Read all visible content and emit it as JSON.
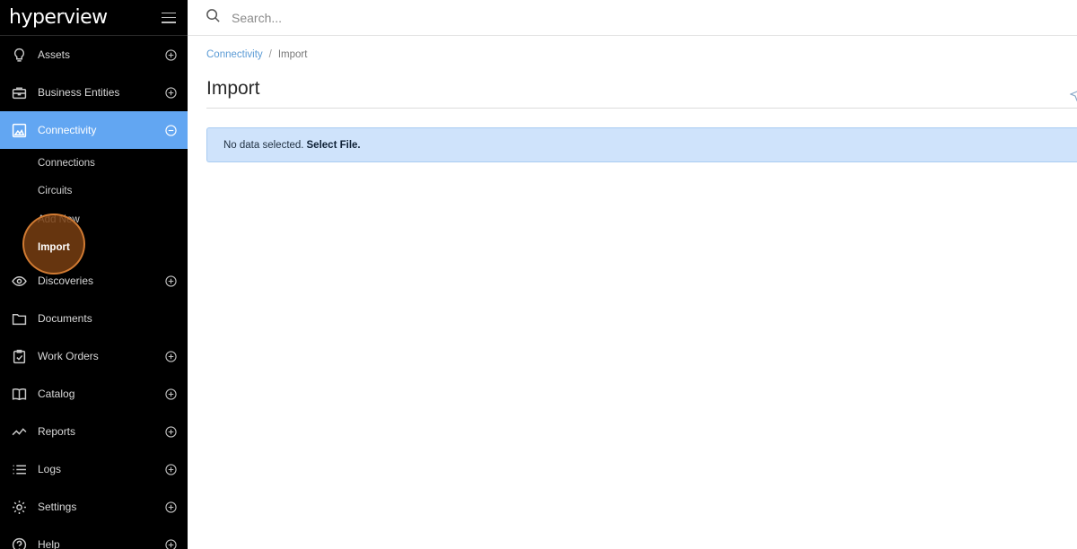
{
  "brand": {
    "logo_text": "hyperview",
    "menu_icon": "hamburger-icon"
  },
  "search": {
    "placeholder": "Search...",
    "value": ""
  },
  "sidebar": {
    "items": [
      {
        "label": "Assets",
        "icon": "lightbulb-icon",
        "toggle": "plus"
      },
      {
        "label": "Business Entities",
        "icon": "briefcase-icon",
        "toggle": "plus"
      },
      {
        "label": "Connectivity",
        "icon": "connectivity-icon",
        "toggle": "minus",
        "active": true,
        "children": [
          "Connections",
          "Circuits",
          "Add New",
          "Import"
        ]
      },
      {
        "label": "Discoveries",
        "icon": "eye-icon",
        "toggle": "plus"
      },
      {
        "label": "Documents",
        "icon": "folder-icon",
        "toggle": ""
      },
      {
        "label": "Work Orders",
        "icon": "clipboard-check-icon",
        "toggle": "plus"
      },
      {
        "label": "Catalog",
        "icon": "book-icon",
        "toggle": "plus"
      },
      {
        "label": "Reports",
        "icon": "line-chart-icon",
        "toggle": "plus"
      },
      {
        "label": "Logs",
        "icon": "list-icon",
        "toggle": "plus"
      },
      {
        "label": "Settings",
        "icon": "gear-icon",
        "toggle": "plus"
      },
      {
        "label": "Help",
        "icon": "help-icon",
        "toggle": "plus"
      }
    ],
    "current_sub": "Import"
  },
  "breadcrumb": {
    "parent": "Connectivity",
    "separator": "/",
    "current": "Import"
  },
  "page": {
    "title": "Import"
  },
  "alert": {
    "text": "No data selected.",
    "link": "Select File."
  },
  "colors": {
    "sidebar_bg": "#000000",
    "active_bg": "#62a6f2",
    "alert_bg": "#cfe3fb",
    "highlight": "#d07a32"
  }
}
